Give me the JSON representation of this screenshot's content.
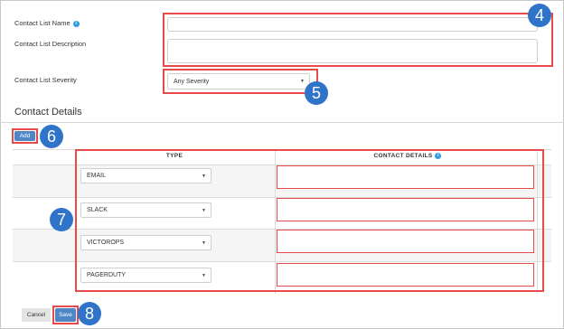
{
  "form": {
    "name_label": "Contact List Name",
    "name_value": "",
    "description_label": "Contact List Description",
    "description_value": "",
    "severity_label": "Contact List Severity",
    "severity_value": "Any Severity"
  },
  "contact_details": {
    "title": "Contact Details",
    "add_label": "Add",
    "columns": [
      "TYPE",
      "CONTACT DETAILS"
    ],
    "rows": [
      {
        "type": "EMAIL",
        "detail": ""
      },
      {
        "type": "SLACK",
        "detail": ""
      },
      {
        "type": "VICTOROPS",
        "detail": ""
      },
      {
        "type": "PAGERDUTY",
        "detail": ""
      }
    ]
  },
  "footer": {
    "cancel_label": "Cancel",
    "save_label": "Save"
  },
  "callouts": [
    "4",
    "5",
    "6",
    "7",
    "8"
  ],
  "colors": {
    "accent": "#4f86c6",
    "highlight": "#e84a4a",
    "callout": "#2f74c8",
    "info": "#2f9ee0"
  },
  "icons": {
    "info": "info-icon",
    "dropdown": "chevron-down-icon"
  }
}
